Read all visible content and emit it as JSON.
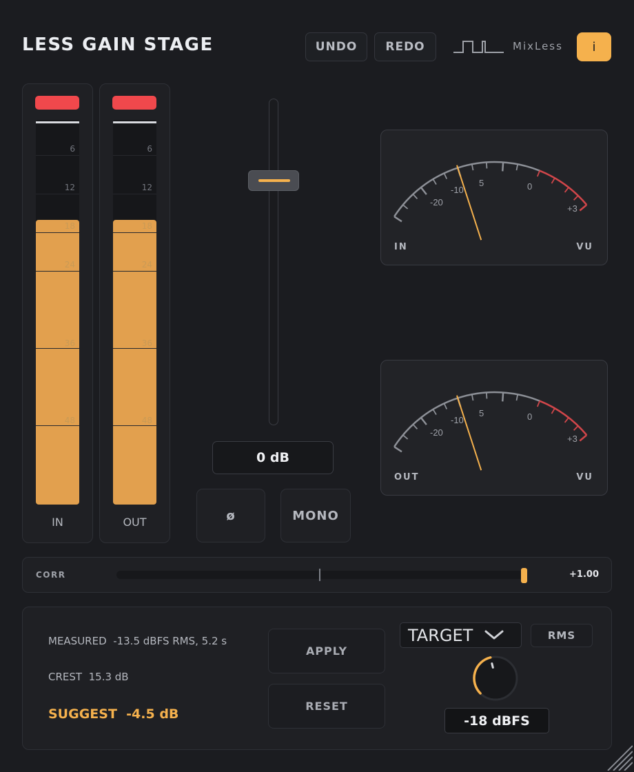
{
  "app": {
    "title": "LESS GAIN STAGE",
    "brand": "MixLess"
  },
  "toolbar": {
    "undo_label": "UNDO",
    "redo_label": "REDO",
    "info_label": "i"
  },
  "meters": {
    "ticks": [
      "6",
      "12",
      "18",
      "24",
      "36",
      "48"
    ],
    "in": {
      "label": "IN",
      "level": 0.74
    },
    "out": {
      "label": "OUT",
      "level": 0.74
    }
  },
  "fader": {
    "value_label": "0 dB",
    "position": 0.25
  },
  "buttons": {
    "phase_label": "ø",
    "mono_label": "MONO"
  },
  "vu": {
    "scale_labels": [
      "-20",
      "-10",
      "5",
      "0",
      "+3"
    ],
    "unit": "VU",
    "in": {
      "label": "IN",
      "needle": "-5"
    },
    "out": {
      "label": "OUT",
      "needle": "-5"
    }
  },
  "correlation": {
    "label": "CORR",
    "value_label": "+1.00",
    "value": 1.0
  },
  "analysis": {
    "measured_label": "MEASURED",
    "measured_value": "-13.5 dBFS RMS, 5.2 s",
    "crest_label": "CREST",
    "crest_value": "15.3 dB",
    "suggest_label": "SUGGEST",
    "suggest_value": "-4.5 dB",
    "apply_label": "APPLY",
    "reset_label": "RESET"
  },
  "target": {
    "dropdown_label": "TARGET",
    "mode_label": "RMS",
    "value_label": "-18 dBFS",
    "knob_level": 0.45
  },
  "colors": {
    "accent": "#f5b14d",
    "meter_fill": "#e2a04e",
    "clip": "#f0484c",
    "background": "#1b1c20"
  }
}
